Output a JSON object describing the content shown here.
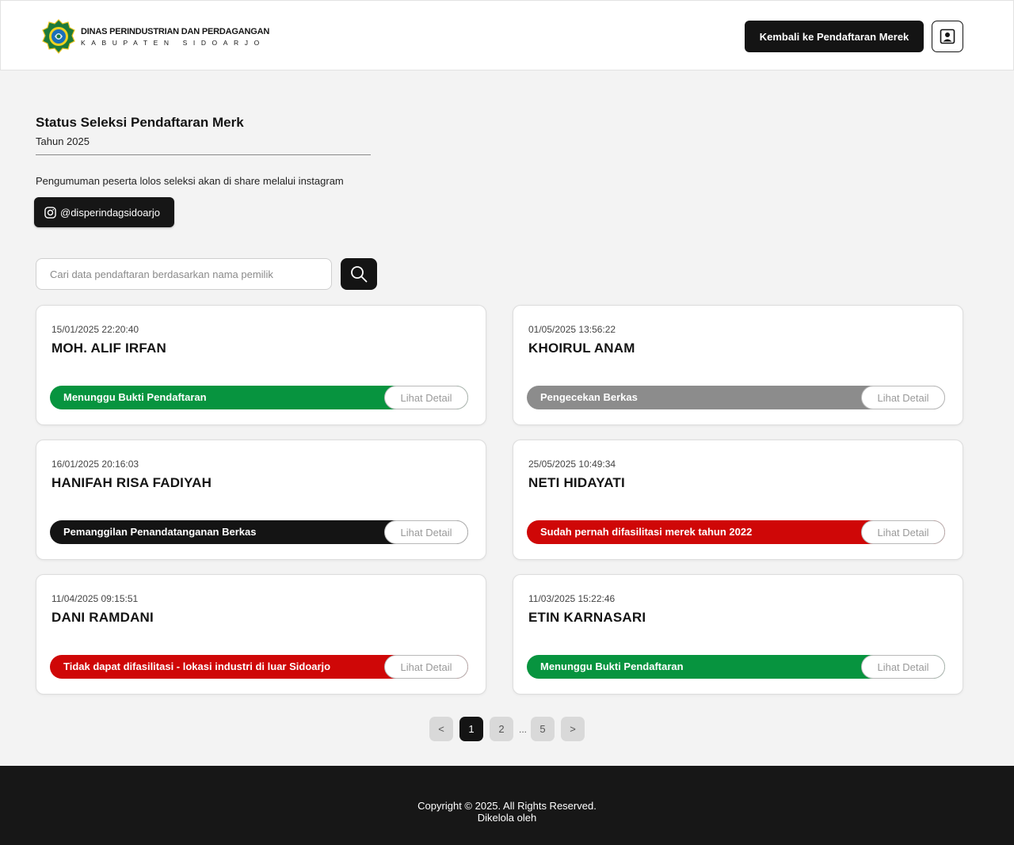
{
  "header": {
    "logo_line1": "DINAS PERINDUSTRIAN DAN PERDAGANGAN",
    "logo_line2": "KABUPATEN SIDOARJO",
    "back_button": "Kembali ke Pendaftaran Merek",
    "profile_icon": "user-profile-icon"
  },
  "intro": {
    "title": "Status Seleksi Pendaftaran Merk",
    "subtitle": "Tahun 2025",
    "announcement": "Pengumuman peserta lolos seleksi akan di share melalui instagram",
    "instagram_handle": "@disperindagsidoarjo",
    "instagram_icon": "instagram-icon"
  },
  "search": {
    "placeholder": "Cari data pendaftaran berdasarkan nama pemilik",
    "value": "",
    "icon": "search-icon"
  },
  "status_colors": {
    "green": "#07943f",
    "gray": "#8c8c8c",
    "black": "#141414",
    "red": "#cf0707"
  },
  "cards": [
    {
      "date": "15/01/2025 22:20:40",
      "name": "MOH. ALIF IRFAN",
      "status": "Menunggu Bukti Pendaftaran",
      "status_color": "#07943f",
      "detail_label": "Lihat Detail"
    },
    {
      "date": "01/05/2025 13:56:22",
      "name": "KHOIRUL ANAM",
      "status": "Pengecekan Berkas",
      "status_color": "#8c8c8c",
      "detail_label": "Lihat Detail"
    },
    {
      "date": "16/01/2025 20:16:03",
      "name": "HANIFAH RISA FADIYAH",
      "status": "Pemanggilan Penandatanganan Berkas",
      "status_color": "#141414",
      "detail_label": "Lihat Detail"
    },
    {
      "date": "25/05/2025 10:49:34",
      "name": "NETI HIDAYATI",
      "status": "Sudah pernah difasilitasi merek tahun 2022",
      "status_color": "#cf0707",
      "detail_label": "Lihat Detail"
    },
    {
      "date": "11/04/2025 09:15:51",
      "name": "DANI RAMDANI",
      "status": "Tidak dapat difasilitasi - lokasi industri di luar Sidoarjo",
      "status_color": "#cf0707",
      "detail_label": "Lihat Detail"
    },
    {
      "date": "11/03/2025 15:22:46",
      "name": "ETIN KARNASARI",
      "status": "Menunggu Bukti Pendaftaran",
      "status_color": "#07943f",
      "detail_label": "Lihat Detail"
    }
  ],
  "pagination": {
    "prev": "<",
    "pages": [
      "1",
      "2",
      "5"
    ],
    "ellipsis": "...",
    "next": ">",
    "current": "1"
  },
  "footer": {
    "copyright": "Copyright © 2025. All Rights Reserved.",
    "managed_by": "Dikelola oleh"
  }
}
